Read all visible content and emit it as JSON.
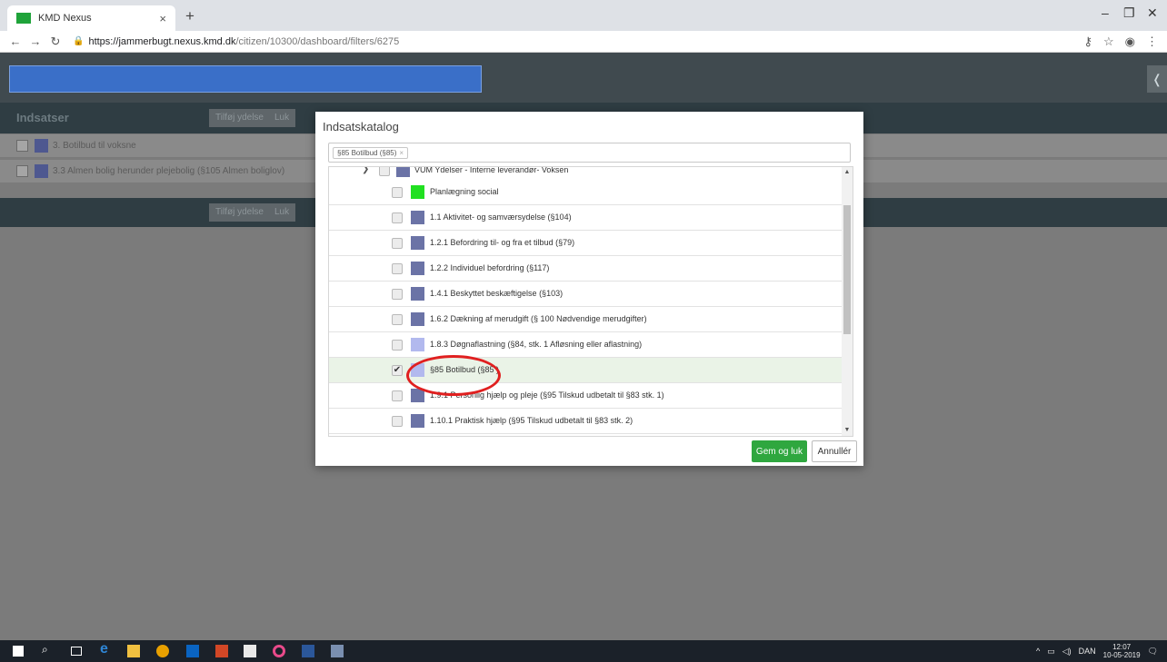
{
  "browser": {
    "tab_title": "KMD Nexus",
    "url_host": "https://jammerbugt.nexus.kmd.dk",
    "url_path": "/citizen/10300/dashboard/filters/6275"
  },
  "app": {
    "section_title": "Indsatser",
    "add_button": "Tilføj ydelse",
    "close_button": "Luk",
    "rows": [
      {
        "label": "3. Botilbud til voksne"
      },
      {
        "label": "3.3 Almen bolig herunder plejebolig (§105 Almen boliglov)"
      }
    ]
  },
  "modal": {
    "title": "Indsatskatalog",
    "filter_chip": "§85 Botilbud (§85)",
    "tree_parent": "VUM Ydelser - Interne leverandør- Voksen",
    "items": [
      {
        "label": "Planlægning social",
        "color": "#21e021",
        "checked": false
      },
      {
        "label": "1.1 Aktivitet- og samværsydelse (§104)",
        "color": "#6b73a6",
        "checked": false
      },
      {
        "label": "1.2.1 Befordring til- og fra et tilbud (§79)",
        "color": "#6b73a6",
        "checked": false
      },
      {
        "label": "1.2.2 Individuel befordring (§117)",
        "color": "#6b73a6",
        "checked": false
      },
      {
        "label": "1.4.1 Beskyttet beskæftigelse (§103)",
        "color": "#6b73a6",
        "checked": false
      },
      {
        "label": "1.6.2 Dækning af merudgift (§ 100 Nødvendige merudgifter)",
        "color": "#6b73a6",
        "checked": false
      },
      {
        "label": "1.8.3 Døgnaflastning (§84, stk. 1 Afløsning eller aflastning)",
        "color": "#b2b9ee",
        "checked": false
      },
      {
        "label": "§85 Botilbud (§85 )",
        "color": "#b2b9ee",
        "checked": true
      },
      {
        "label": "1.9.1 Personlig hjælp og pleje (§95 Tilskud udbetalt til §83 stk. 1)",
        "color": "#6b73a6",
        "checked": false
      },
      {
        "label": "1.10.1 Praktisk hjælp (§95 Tilskud udbetalt til §83 stk. 2)",
        "color": "#6b73a6",
        "checked": false
      }
    ],
    "save_button": "Gem og luk",
    "cancel_button": "Annullér"
  },
  "taskbar": {
    "language": "DAN",
    "time": "12:07",
    "date": "10-05-2019"
  }
}
